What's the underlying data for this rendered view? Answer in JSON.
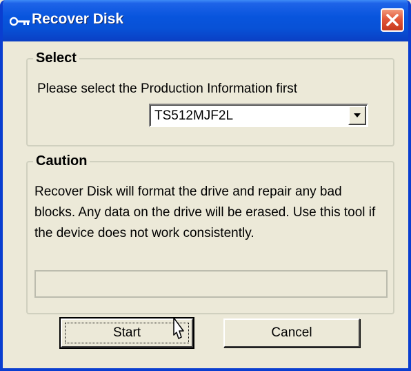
{
  "window": {
    "title": "Recover Disk"
  },
  "select_group": {
    "title": "Select",
    "prompt": "Please select the Production Information first",
    "dropdown_value": "TS512MJF2L"
  },
  "caution_group": {
    "title": "Caution",
    "text": "Recover Disk will format the drive and repair any bad blocks. Any data on the drive will be erased. Use this tool if the device does not work consistently.",
    "progress": 0
  },
  "buttons": {
    "start": "Start",
    "cancel": "Cancel"
  },
  "icons": {
    "title": "key-icon",
    "close": "close-icon",
    "dropdown": "chevron-down-icon",
    "cursor": "mouse-pointer-icon"
  },
  "colors": {
    "titlebar": "#0855DD",
    "close_button": "#E2573A",
    "dialog_bg": "#ECE9D8"
  }
}
